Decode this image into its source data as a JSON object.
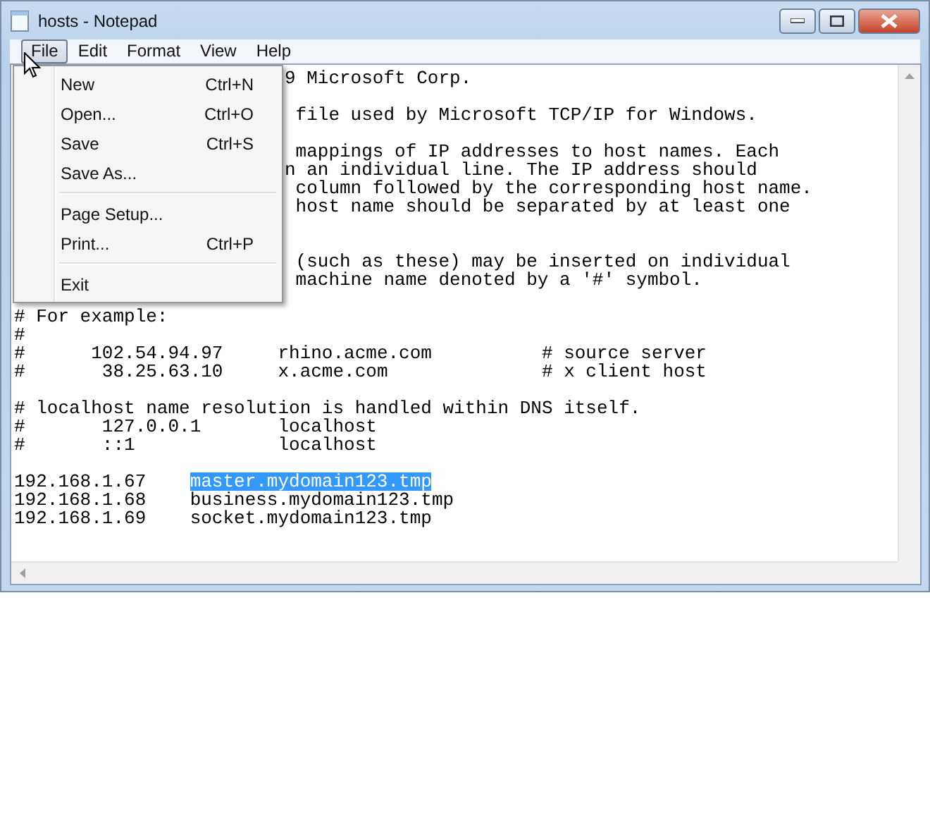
{
  "window": {
    "title": "hosts - Notepad"
  },
  "menu_bar": [
    {
      "label": "File",
      "selected": true
    },
    {
      "label": "Edit",
      "selected": false
    },
    {
      "label": "Format",
      "selected": false
    },
    {
      "label": "View",
      "selected": false
    },
    {
      "label": "Help",
      "selected": false
    }
  ],
  "file_menu": [
    {
      "kind": "item",
      "label": "New",
      "shortcut": "Ctrl+N"
    },
    {
      "kind": "item",
      "label": "Open...",
      "shortcut": "Ctrl+O"
    },
    {
      "kind": "item",
      "label": "Save",
      "shortcut": "Ctrl+S"
    },
    {
      "kind": "item",
      "label": "Save As..."
    },
    {
      "kind": "separator"
    },
    {
      "kind": "item",
      "label": "Page Setup..."
    },
    {
      "kind": "item",
      "label": "Print...",
      "shortcut": "Ctrl+P"
    },
    {
      "kind": "separator"
    },
    {
      "kind": "item",
      "label": "Exit"
    }
  ],
  "editor": {
    "lines": [
      {
        "kind": "covered",
        "text": "9 Microsoft Corp."
      },
      {
        "kind": "blank"
      },
      {
        "kind": "covered",
        "text": " file used by Microsoft TCP/IP for Windows."
      },
      {
        "kind": "blank"
      },
      {
        "kind": "covered",
        "text": " mappings of IP addresses to host names. Each"
      },
      {
        "kind": "covered",
        "text": "n an individual line. The IP address should"
      },
      {
        "kind": "covered",
        "text": " column followed by the corresponding host name."
      },
      {
        "kind": "covered",
        "text": " host name should be separated by at least one"
      },
      {
        "kind": "blank"
      },
      {
        "kind": "blank"
      },
      {
        "kind": "covered",
        "text": " (such as these) may be inserted on individual"
      },
      {
        "kind": "covered",
        "text": " machine name denoted by a '#' symbol."
      },
      {
        "kind": "blank"
      },
      {
        "kind": "text",
        "text": "# For example:"
      },
      {
        "kind": "text",
        "text": "#"
      },
      {
        "kind": "text",
        "text": "#      102.54.94.97     rhino.acme.com          # source server"
      },
      {
        "kind": "text",
        "text": "#       38.25.63.10     x.acme.com              # x client host"
      },
      {
        "kind": "blank"
      },
      {
        "kind": "text",
        "text": "# localhost name resolution is handled within DNS itself."
      },
      {
        "kind": "text",
        "text": "#       127.0.0.1       localhost"
      },
      {
        "kind": "text",
        "text": "#       ::1             localhost"
      },
      {
        "kind": "blank"
      },
      {
        "kind": "entry",
        "address": "192.168.1.67",
        "host": "master.mydomain123.tmp",
        "selected": true
      },
      {
        "kind": "entry",
        "address": "192.168.1.68",
        "host": "business.mydomain123.tmp",
        "selected": false
      },
      {
        "kind": "entry",
        "address": "192.168.1.69",
        "host": "socket.mydomain123.tmp",
        "selected": false
      }
    ]
  }
}
